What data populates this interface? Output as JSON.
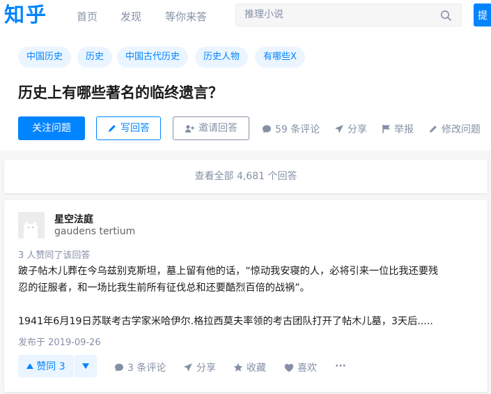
{
  "header": {
    "logo": "知乎",
    "nav": [
      "首页",
      "发现",
      "等你来答"
    ],
    "search_placeholder": "推理小说",
    "ask_label": "提"
  },
  "question": {
    "tags": [
      "中国历史",
      "历史",
      "中国古代历史",
      "历史人物",
      "有哪些X"
    ],
    "title": "历史上有哪些著名的临终遗言？",
    "follow_label": "关注问题",
    "write_label": "写回答",
    "invite_label": "邀请回答",
    "comments_label": "59 条评论",
    "share_label": "分享",
    "report_label": "举报",
    "edit_label": "修改问题"
  },
  "view_all": "查看全部 4,681 个回答",
  "answer": {
    "author_name": "星空法庭",
    "author_bio": "gaudens tertium",
    "upvoters": "3 人赞同了该回答",
    "paragraphs": [
      "跛子帖木儿葬在今乌兹别克斯坦，墓上留有他的话，“惊动我安寝的人，必将引来一位比我还要残忍的征服者，和一场比我生前所有征伐总和还要酷烈百倍的战祸”。",
      "1941年6月19日苏联考古学家米哈伊尔.格拉西莫夫率领的考古团队打开了帖木儿墓，3天后....."
    ],
    "para1_line1": "跛子帖木儿葬在今乌兹别克斯坦，墓上留有他的话，“惊动我安寝的人，必将引来一位比我还要残",
    "para1_line2": "忍的征服者，和一场比我生前所有征伐总和还要酷烈百倍的战祸”。",
    "published": "发布于 2019-09-26",
    "vote_label": "赞同 3",
    "comments_label": "3 条评论",
    "share_label": "分享",
    "collect_label": "收藏",
    "like_label": "喜欢",
    "more_label": "···"
  },
  "colors": {
    "brand": "#0084ff",
    "tag_bg": "#ebf5ff",
    "muted": "#8590a6"
  }
}
